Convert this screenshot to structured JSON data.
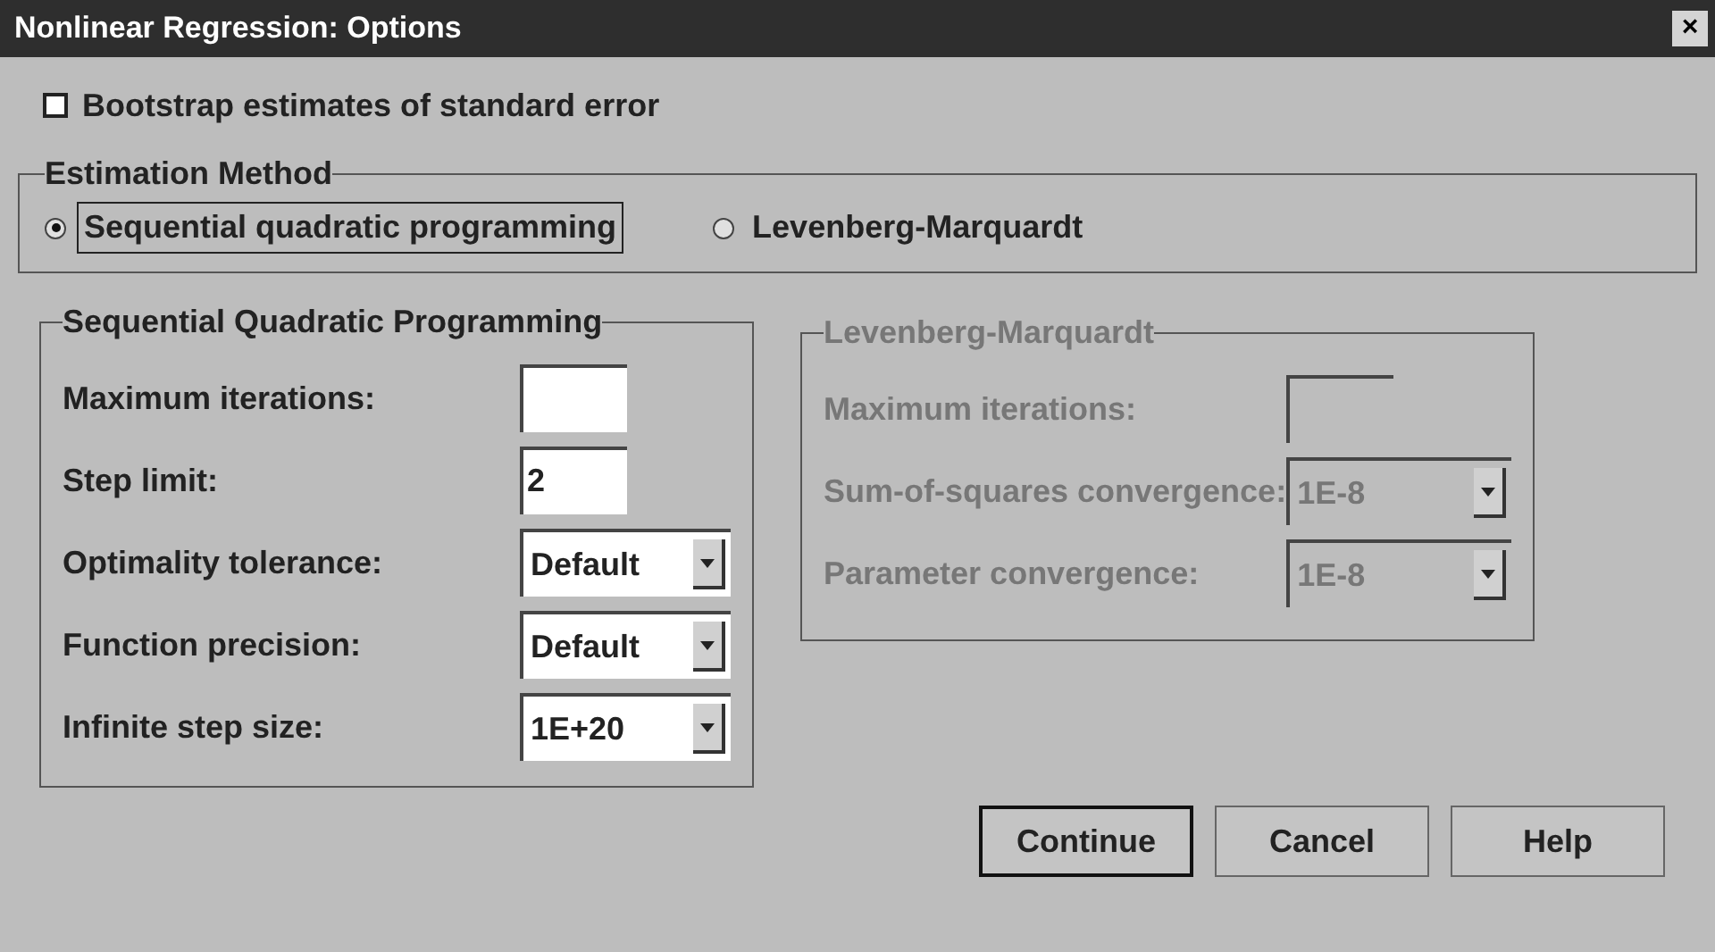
{
  "window": {
    "title": "Nonlinear Regression: Options",
    "close": "×"
  },
  "bootstrap": {
    "label": "Bootstrap estimates of standard error",
    "checked": false
  },
  "estimation_method": {
    "title": "Estimation Method",
    "options": [
      {
        "label": "Sequential quadratic programming",
        "selected": true
      },
      {
        "label": "Levenberg-Marquardt",
        "selected": false
      }
    ]
  },
  "groups": [
    {
      "title": "Sequential Quadratic Programming",
      "disabled": false,
      "fields": [
        {
          "label": "Maximum iterations:",
          "kind": "text"
        },
        {
          "label": "Step limit:",
          "kind": "text",
          "value": "2"
        },
        {
          "label": "Optimality tolerance:",
          "kind": "dropdown",
          "value": "Default"
        },
        {
          "label": "Function precision:",
          "kind": "dropdown",
          "value": "Default"
        },
        {
          "label": "Infinite step size:",
          "kind": "dropdown",
          "value": "1E+20"
        }
      ]
    },
    {
      "title": "Levenberg-Marquardt",
      "disabled": true,
      "fields": [
        {
          "label": "Maximum iterations:",
          "kind": "text"
        },
        {
          "label": "Sum-of-squares convergence:",
          "kind": "dropdown",
          "value": "1E-8"
        },
        {
          "label": "Parameter convergence:",
          "kind": "dropdown",
          "value": "1E-8"
        }
      ]
    }
  ],
  "buttons": [
    {
      "label": "Continue",
      "default": true
    },
    {
      "label": "Cancel",
      "default": false
    },
    {
      "label": "Help",
      "default": false
    }
  ]
}
